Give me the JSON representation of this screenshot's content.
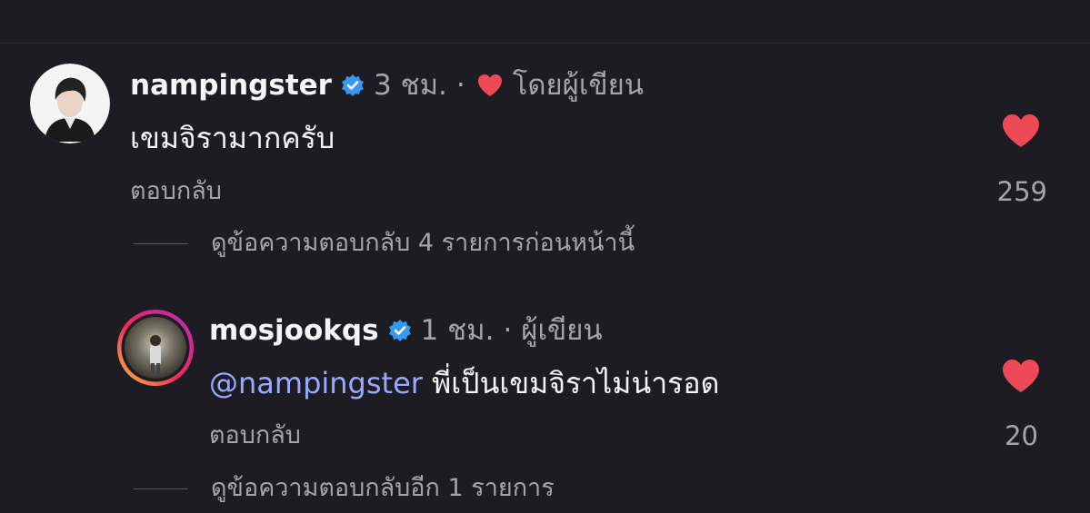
{
  "comments": [
    {
      "username": "nampingster",
      "time": "3 ชม.",
      "separator": "·",
      "author_tag": "โดยผู้เขียน",
      "text": "เขมจิรามากครับ",
      "reply_label": "ตอบกลับ",
      "like_count": "259",
      "view_replies": "ดูข้อความตอบกลับ 4 รายการก่อนหน้านี้"
    },
    {
      "username": "mosjookqs",
      "time": "1 ชม.",
      "separator": "·",
      "author_tag": "ผู้เขียน",
      "mention": "@nampingster",
      "text": "พี่เป็นเขมจิราไม่น่ารอด",
      "reply_label": "ตอบกลับ",
      "like_count": "20",
      "view_replies": "ดูข้อความตอบกลับอีก 1 รายการ"
    }
  ],
  "colors": {
    "background": "#1c1c22",
    "like_red": "#ed4956",
    "verified_blue": "#3897f0",
    "mention_blue": "#9aa8ff",
    "secondary_text": "#a4a4ab"
  },
  "icons": {
    "verified": "verified-badge-icon",
    "author_heart": "heart-icon",
    "like": "heart-filled-icon"
  }
}
